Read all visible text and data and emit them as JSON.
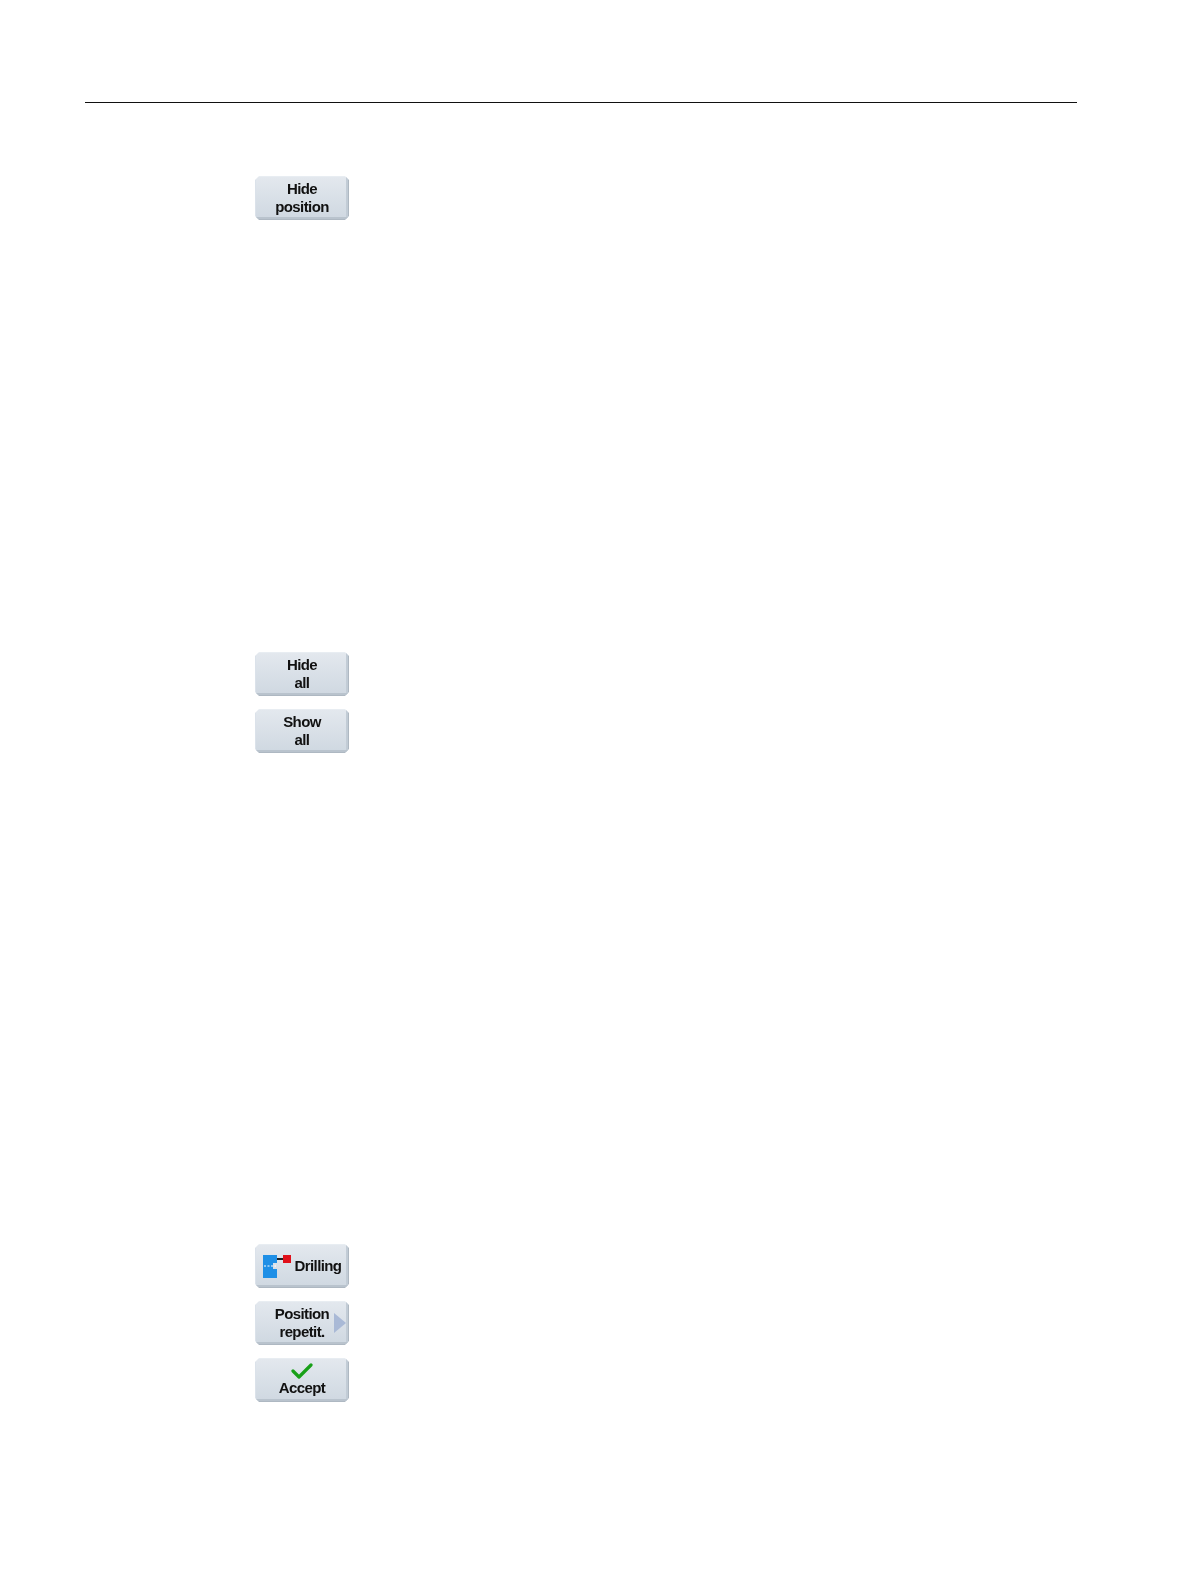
{
  "softkey_groups": [
    {
      "softkeys": [
        {
          "kind": "text",
          "lines": [
            "Hide",
            "position"
          ]
        }
      ]
    },
    {
      "softkeys": [
        {
          "kind": "text",
          "lines": [
            "Hide",
            "all"
          ]
        },
        {
          "kind": "text",
          "lines": [
            "Show",
            "all"
          ]
        }
      ]
    },
    {
      "softkeys": [
        {
          "kind": "drilling",
          "lines": [
            "Drilling"
          ]
        },
        {
          "kind": "submenu",
          "lines": [
            "Position",
            "repetit."
          ]
        },
        {
          "kind": "confirm",
          "lines": [
            "Accept"
          ]
        }
      ]
    }
  ]
}
